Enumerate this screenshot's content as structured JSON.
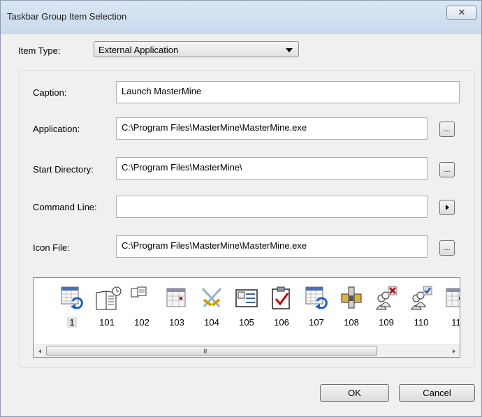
{
  "window": {
    "title": "Taskbar Group Item Selection",
    "close_glyph": "✕"
  },
  "item_type": {
    "label": "Item Type:",
    "selected": "External Application"
  },
  "fields": {
    "caption": {
      "label": "Caption:",
      "value": "Launch MasterMine"
    },
    "application": {
      "label": "Application:",
      "value": "C:\\Program Files\\MasterMine\\MasterMine.exe",
      "browse_label": "..."
    },
    "start_directory": {
      "label": "Start Directory:",
      "value": "C:\\Program Files\\MasterMine\\",
      "browse_label": "..."
    },
    "command_line": {
      "label": "Command Line:",
      "value": ""
    },
    "icon_file": {
      "label": "Icon File:",
      "value": "C:\\Program Files\\MasterMine\\MasterMine.exe",
      "browse_label": "..."
    }
  },
  "icons": [
    {
      "number": "1",
      "icon": "calendar-refresh-icon",
      "selected": true
    },
    {
      "number": "101",
      "icon": "book-clock-icon",
      "selected": false
    },
    {
      "number": "102",
      "icon": "small-document-icon",
      "selected": false
    },
    {
      "number": "103",
      "icon": "calendar-icon",
      "selected": false
    },
    {
      "number": "104",
      "icon": "crossed-swords-icon",
      "selected": false
    },
    {
      "number": "105",
      "icon": "card-list-icon",
      "selected": false
    },
    {
      "number": "106",
      "icon": "clipboard-check-icon",
      "selected": false
    },
    {
      "number": "107",
      "icon": "calendar-refresh-icon",
      "selected": false
    },
    {
      "number": "108",
      "icon": "joystick-icon",
      "selected": false
    },
    {
      "number": "109",
      "icon": "users-remove-icon",
      "selected": false
    },
    {
      "number": "110",
      "icon": "users-check-icon",
      "selected": false
    },
    {
      "number": "11",
      "icon": "calendar-icon",
      "selected": false
    }
  ],
  "scrollbar": {
    "grip": "III"
  },
  "buttons": {
    "ok": "OK",
    "cancel": "Cancel"
  },
  "colors": {
    "selection_bg": "#e0e0e0",
    "accent_blue": "#1f5fbf",
    "red_mark": "#c00000"
  }
}
